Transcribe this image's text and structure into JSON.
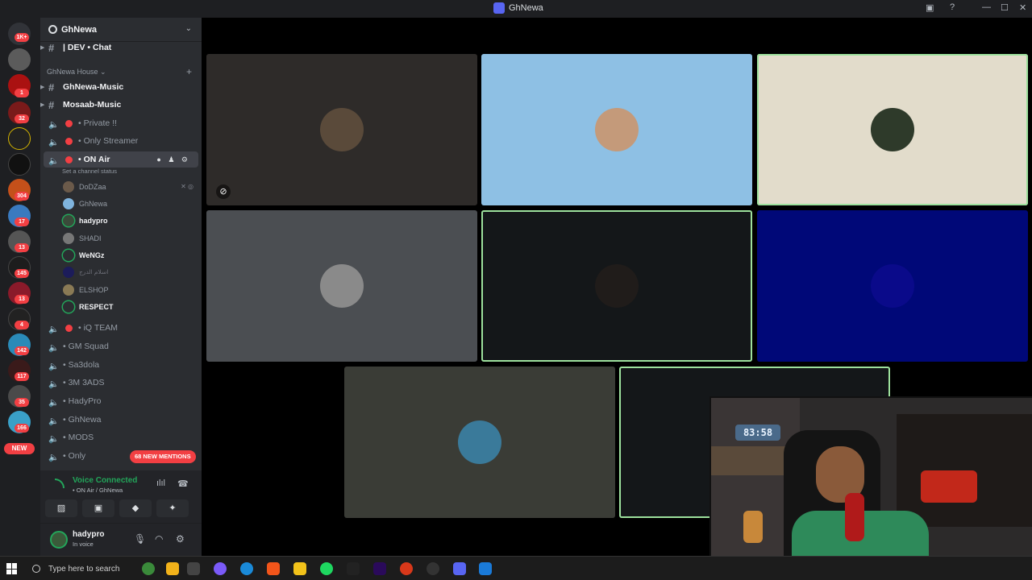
{
  "window": {
    "title": "GhNewa"
  },
  "rail": {
    "badges": [
      "1K+",
      "1",
      "32",
      "304",
      "17",
      "13",
      "145",
      "13",
      "4",
      "142",
      "117",
      "35",
      "166"
    ],
    "new_label": "NEW"
  },
  "sidebar": {
    "guild_name": "GhNewa",
    "top_channel": "| DEV • Chat",
    "category": "GhNewa House",
    "text_channels": [
      "GhNewa-Music",
      "Mosaab-Music"
    ],
    "voice_channels_top": [
      {
        "label": "• Private !!",
        "dot": true
      },
      {
        "label": "• Only Streamer",
        "dot": true
      }
    ],
    "active_channel": {
      "label": "• ON Air",
      "status": "Set a channel status"
    },
    "members": [
      {
        "name": "DoDZaa",
        "bold": false
      },
      {
        "name": "GhNewa",
        "bold": false
      },
      {
        "name": "hadypro",
        "bold": true
      },
      {
        "name": "SHADI",
        "bold": false
      },
      {
        "name": "WeNGz",
        "bold": true
      },
      {
        "name": "اسلام الدرج",
        "bold": false
      },
      {
        "name": "ELSHOP",
        "bold": false
      },
      {
        "name": "RESPECT",
        "bold": true
      }
    ],
    "voice_channels_bottom": [
      {
        "label": "• iQ TEAM",
        "dot": true
      },
      {
        "label": "• GM Squad",
        "dot": false
      },
      {
        "label": "• Sa3dola",
        "dot": false
      },
      {
        "label": "• 3M 3ADS",
        "dot": false
      },
      {
        "label": "• HadyPro",
        "dot": false
      },
      {
        "label": "• GhNewa",
        "dot": false
      },
      {
        "label": "• MODS",
        "dot": false
      },
      {
        "label": "• Only",
        "dot": false
      }
    ],
    "mentions_pill": "68 NEW MENTIONS"
  },
  "voice_panel": {
    "status": "Voice Connected",
    "location": "• ON Air / GhNewa"
  },
  "user_panel": {
    "username": "hadypro",
    "status": "In voice"
  },
  "webcam": {
    "clock": "83:58"
  },
  "taskbar": {
    "search_placeholder": "Type here to search"
  },
  "colors": {
    "green": "#23a55a",
    "red": "#f23f43",
    "tile_talk_border": "#9de19d"
  }
}
